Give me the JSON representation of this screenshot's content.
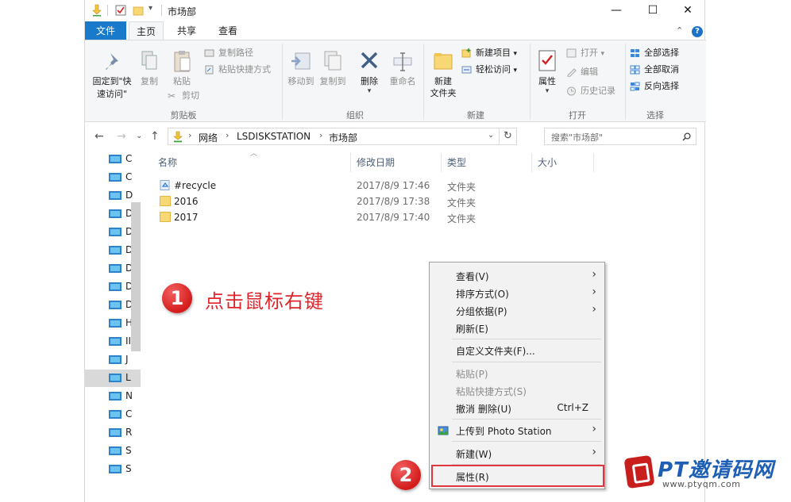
{
  "window": {
    "title": "市场部",
    "controls": {
      "minimize": "—",
      "maximize": "☐",
      "close": "✕"
    }
  },
  "tabs": {
    "file": "文件",
    "home": "主页",
    "share": "共享",
    "view": "查看"
  },
  "ribbon": {
    "clipboard": {
      "pin_quick": "固定到\"快速访问\"",
      "copy": "复制",
      "paste": "粘贴",
      "copy_path": "复制路径",
      "paste_shortcut": "粘贴快捷方式",
      "cut": "剪切",
      "group": "剪贴板"
    },
    "organize": {
      "move_to": "移动到",
      "copy_to": "复制到",
      "delete": "删除",
      "rename": "重命名",
      "group": "组织"
    },
    "new": {
      "new_folder": "新建\n文件夹",
      "new_item": "新建项目",
      "easy_access": "轻松访问",
      "group": "新建"
    },
    "open": {
      "properties": "属性",
      "open": "打开",
      "edit": "编辑",
      "history": "历史记录",
      "group": "打开"
    },
    "select": {
      "select_all": "全部选择",
      "select_none": "全部取消",
      "invert": "反向选择",
      "group": "选择"
    }
  },
  "address": {
    "segments": [
      "网络",
      "LSDISKSTATION",
      "市场部"
    ],
    "search_placeholder": "搜索\"市场部\""
  },
  "nav_items": [
    "C",
    "C",
    "D",
    "D",
    "D",
    "D",
    "D",
    "D",
    "D",
    "H",
    "II",
    "J",
    "L",
    "N",
    "C",
    "R",
    "S",
    "S"
  ],
  "columns": {
    "name": "名称",
    "date": "修改日期",
    "type": "类型",
    "size": "大小"
  },
  "files": [
    {
      "name": "#recycle",
      "date": "2017/8/9 17:46",
      "type": "文件夹"
    },
    {
      "name": "2016",
      "date": "2017/8/9 17:38",
      "type": "文件夹"
    },
    {
      "name": "2017",
      "date": "2017/8/9 17:40",
      "type": "文件夹"
    }
  ],
  "context_menu": {
    "view": "查看(V)",
    "sort": "排序方式(O)",
    "group": "分组依据(P)",
    "refresh": "刷新(E)",
    "customize": "自定义文件夹(F)...",
    "paste": "粘贴(P)",
    "paste_shortcut": "粘贴快捷方式(S)",
    "undo": "撤消 删除(U)",
    "undo_shortcut": "Ctrl+Z",
    "upload": "上传到 Photo Station",
    "new": "新建(W)",
    "properties": "属性(R)"
  },
  "annotations": {
    "step1_number": "1",
    "step1_text": "点击鼠标右键",
    "step2_number": "2"
  },
  "watermark": {
    "main": "PT邀请码网",
    "url": "www.ptyqm.com"
  },
  "colors": {
    "accent": "#1979ca",
    "annotation": "#e0242c",
    "folder": "#f8d775"
  }
}
